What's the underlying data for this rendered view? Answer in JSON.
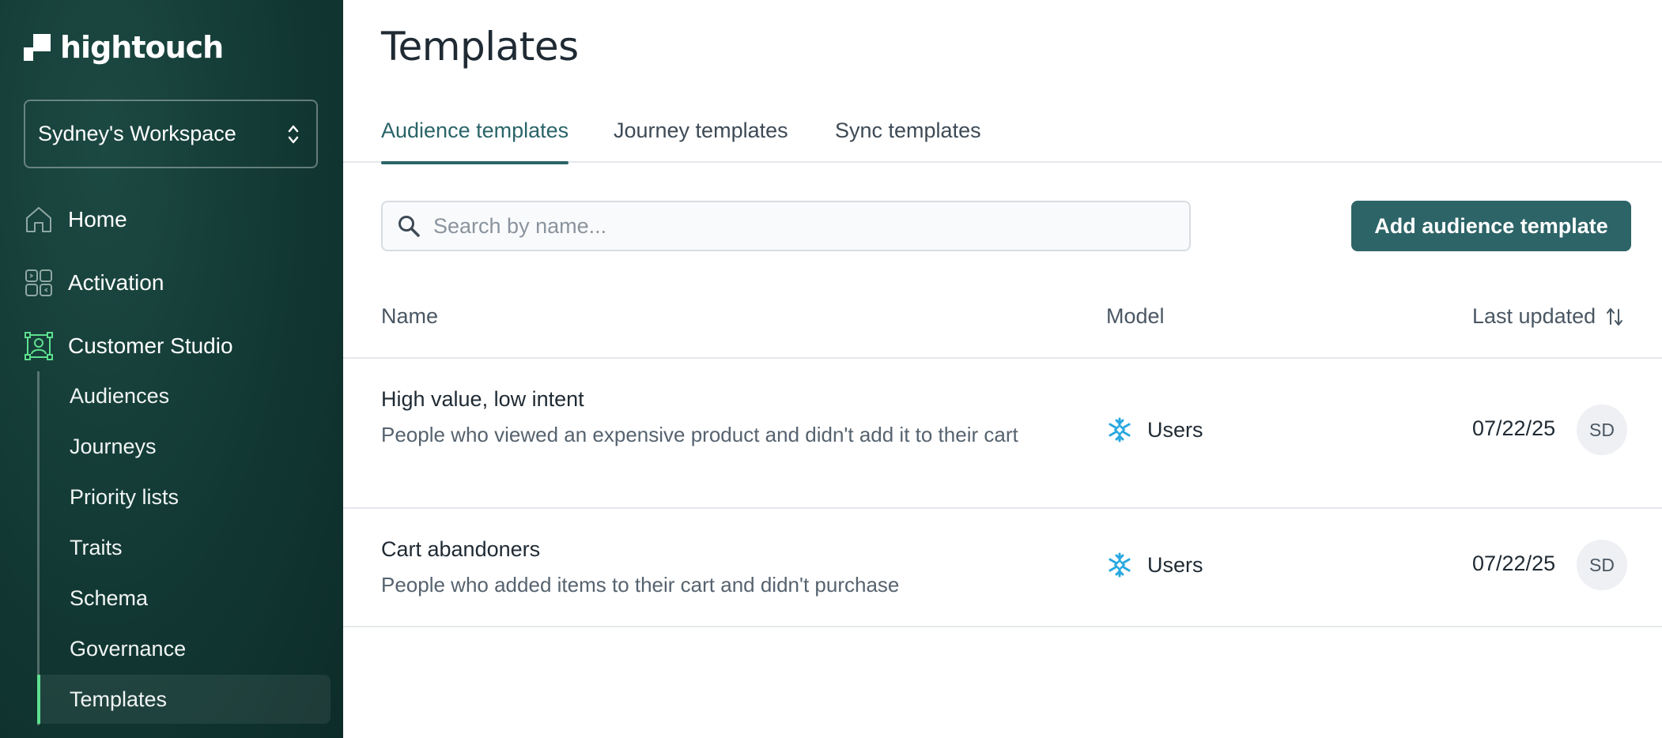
{
  "sidebar": {
    "logo_text": "hightouch",
    "workspace": "Sydney's Workspace",
    "nav": [
      {
        "label": "Home",
        "icon": "home-icon"
      },
      {
        "label": "Activation",
        "icon": "activation-icon"
      },
      {
        "label": "Customer Studio",
        "icon": "customer-studio-icon"
      }
    ],
    "subnav": [
      {
        "label": "Audiences"
      },
      {
        "label": "Journeys"
      },
      {
        "label": "Priority lists"
      },
      {
        "label": "Traits"
      },
      {
        "label": "Schema"
      },
      {
        "label": "Governance"
      },
      {
        "label": "Templates",
        "active": true
      }
    ]
  },
  "main": {
    "title": "Templates",
    "tabs": [
      {
        "label": "Audience templates",
        "active": true
      },
      {
        "label": "Journey templates"
      },
      {
        "label": "Sync templates"
      }
    ],
    "search": {
      "placeholder": "Search by name...",
      "value": ""
    },
    "add_button": "Add audience template",
    "table": {
      "columns": [
        "Name",
        "Model",
        "Last updated"
      ],
      "rows": [
        {
          "name": "High value, low intent",
          "description": "People who viewed an expensive product and didn't add it to their cart",
          "model": "Users",
          "model_icon": "snowflake-icon",
          "last_updated": "07/22/25",
          "avatar": "SD"
        },
        {
          "name": "Cart abandoners",
          "description": "People who added items to their cart and didn't purchase",
          "model": "Users",
          "model_icon": "snowflake-icon",
          "last_updated": "07/22/25",
          "avatar": "SD"
        }
      ]
    }
  },
  "colors": {
    "sidebar_bg": "#123833",
    "accent": "#2d6467",
    "active_indicator": "#5ee08f",
    "snowflake": "#29a8e0"
  }
}
